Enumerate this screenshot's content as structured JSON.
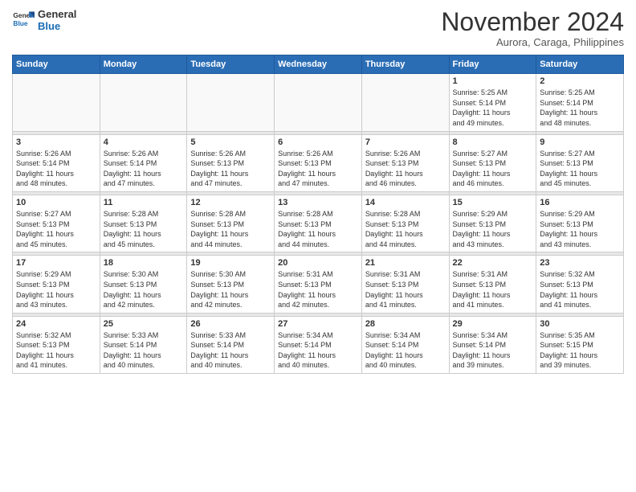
{
  "logo": {
    "line1": "General",
    "line2": "Blue"
  },
  "title": "November 2024",
  "subtitle": "Aurora, Caraga, Philippines",
  "weekdays": [
    "Sunday",
    "Monday",
    "Tuesday",
    "Wednesday",
    "Thursday",
    "Friday",
    "Saturday"
  ],
  "weeks": [
    [
      {
        "day": "",
        "info": ""
      },
      {
        "day": "",
        "info": ""
      },
      {
        "day": "",
        "info": ""
      },
      {
        "day": "",
        "info": ""
      },
      {
        "day": "",
        "info": ""
      },
      {
        "day": "1",
        "info": "Sunrise: 5:25 AM\nSunset: 5:14 PM\nDaylight: 11 hours\nand 49 minutes."
      },
      {
        "day": "2",
        "info": "Sunrise: 5:25 AM\nSunset: 5:14 PM\nDaylight: 11 hours\nand 48 minutes."
      }
    ],
    [
      {
        "day": "3",
        "info": "Sunrise: 5:26 AM\nSunset: 5:14 PM\nDaylight: 11 hours\nand 48 minutes."
      },
      {
        "day": "4",
        "info": "Sunrise: 5:26 AM\nSunset: 5:14 PM\nDaylight: 11 hours\nand 47 minutes."
      },
      {
        "day": "5",
        "info": "Sunrise: 5:26 AM\nSunset: 5:13 PM\nDaylight: 11 hours\nand 47 minutes."
      },
      {
        "day": "6",
        "info": "Sunrise: 5:26 AM\nSunset: 5:13 PM\nDaylight: 11 hours\nand 47 minutes."
      },
      {
        "day": "7",
        "info": "Sunrise: 5:26 AM\nSunset: 5:13 PM\nDaylight: 11 hours\nand 46 minutes."
      },
      {
        "day": "8",
        "info": "Sunrise: 5:27 AM\nSunset: 5:13 PM\nDaylight: 11 hours\nand 46 minutes."
      },
      {
        "day": "9",
        "info": "Sunrise: 5:27 AM\nSunset: 5:13 PM\nDaylight: 11 hours\nand 45 minutes."
      }
    ],
    [
      {
        "day": "10",
        "info": "Sunrise: 5:27 AM\nSunset: 5:13 PM\nDaylight: 11 hours\nand 45 minutes."
      },
      {
        "day": "11",
        "info": "Sunrise: 5:28 AM\nSunset: 5:13 PM\nDaylight: 11 hours\nand 45 minutes."
      },
      {
        "day": "12",
        "info": "Sunrise: 5:28 AM\nSunset: 5:13 PM\nDaylight: 11 hours\nand 44 minutes."
      },
      {
        "day": "13",
        "info": "Sunrise: 5:28 AM\nSunset: 5:13 PM\nDaylight: 11 hours\nand 44 minutes."
      },
      {
        "day": "14",
        "info": "Sunrise: 5:28 AM\nSunset: 5:13 PM\nDaylight: 11 hours\nand 44 minutes."
      },
      {
        "day": "15",
        "info": "Sunrise: 5:29 AM\nSunset: 5:13 PM\nDaylight: 11 hours\nand 43 minutes."
      },
      {
        "day": "16",
        "info": "Sunrise: 5:29 AM\nSunset: 5:13 PM\nDaylight: 11 hours\nand 43 minutes."
      }
    ],
    [
      {
        "day": "17",
        "info": "Sunrise: 5:29 AM\nSunset: 5:13 PM\nDaylight: 11 hours\nand 43 minutes."
      },
      {
        "day": "18",
        "info": "Sunrise: 5:30 AM\nSunset: 5:13 PM\nDaylight: 11 hours\nand 42 minutes."
      },
      {
        "day": "19",
        "info": "Sunrise: 5:30 AM\nSunset: 5:13 PM\nDaylight: 11 hours\nand 42 minutes."
      },
      {
        "day": "20",
        "info": "Sunrise: 5:31 AM\nSunset: 5:13 PM\nDaylight: 11 hours\nand 42 minutes."
      },
      {
        "day": "21",
        "info": "Sunrise: 5:31 AM\nSunset: 5:13 PM\nDaylight: 11 hours\nand 41 minutes."
      },
      {
        "day": "22",
        "info": "Sunrise: 5:31 AM\nSunset: 5:13 PM\nDaylight: 11 hours\nand 41 minutes."
      },
      {
        "day": "23",
        "info": "Sunrise: 5:32 AM\nSunset: 5:13 PM\nDaylight: 11 hours\nand 41 minutes."
      }
    ],
    [
      {
        "day": "24",
        "info": "Sunrise: 5:32 AM\nSunset: 5:13 PM\nDaylight: 11 hours\nand 41 minutes."
      },
      {
        "day": "25",
        "info": "Sunrise: 5:33 AM\nSunset: 5:14 PM\nDaylight: 11 hours\nand 40 minutes."
      },
      {
        "day": "26",
        "info": "Sunrise: 5:33 AM\nSunset: 5:14 PM\nDaylight: 11 hours\nand 40 minutes."
      },
      {
        "day": "27",
        "info": "Sunrise: 5:34 AM\nSunset: 5:14 PM\nDaylight: 11 hours\nand 40 minutes."
      },
      {
        "day": "28",
        "info": "Sunrise: 5:34 AM\nSunset: 5:14 PM\nDaylight: 11 hours\nand 40 minutes."
      },
      {
        "day": "29",
        "info": "Sunrise: 5:34 AM\nSunset: 5:14 PM\nDaylight: 11 hours\nand 39 minutes."
      },
      {
        "day": "30",
        "info": "Sunrise: 5:35 AM\nSunset: 5:15 PM\nDaylight: 11 hours\nand 39 minutes."
      }
    ]
  ]
}
